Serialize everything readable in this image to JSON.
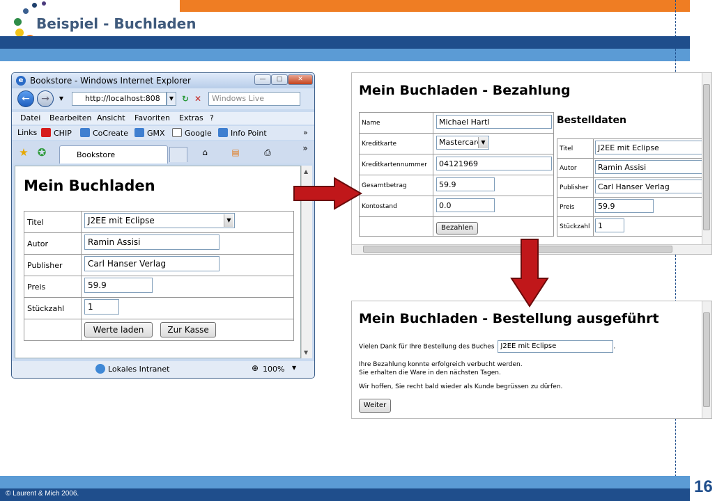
{
  "slide": {
    "title": "Beispiel - Buchladen",
    "copyright": "© Laurent & Mich 2006.",
    "page_number": "16",
    "colors": {
      "navy": "#1f4e8c",
      "light_blue": "#5b9bd5",
      "orange": "#ef7d23",
      "arrow_red": "#c0171a"
    }
  },
  "browser": {
    "window_title": "Bookstore - Windows Internet Explorer",
    "address": "http://localhost:808",
    "search_placeholder": "Windows Live",
    "menu": [
      "Datei",
      "Bearbeiten",
      "Ansicht",
      "Favoriten",
      "Extras",
      "?"
    ],
    "links_label": "Links",
    "links": [
      "CHIP",
      "CoCreate",
      "GMX",
      "Google",
      "Info Point"
    ],
    "tab_title": "Bookstore",
    "status_zone": "Lokales Intranet",
    "zoom": "100%"
  },
  "shop": {
    "heading": "Mein Buchladen",
    "rows": [
      {
        "label": "Titel",
        "value": "J2EE mit Eclipse"
      },
      {
        "label": "Autor",
        "value": "Ramin Assisi"
      },
      {
        "label": "Publisher",
        "value": "Carl Hanser Verlag"
      },
      {
        "label": "Preis",
        "value": "59.9"
      },
      {
        "label": "Stückzahl",
        "value": "1"
      }
    ],
    "load_button": "Werte laden",
    "checkout_button": "Zur Kasse"
  },
  "payment": {
    "heading": "Mein Buchladen - Bezahlung",
    "rows": [
      {
        "label": "Name",
        "value": "Michael Hartl"
      },
      {
        "label": "Kreditkarte",
        "value": "Mastercard"
      },
      {
        "label": "Kreditkartennummer",
        "value": "04121969"
      },
      {
        "label": "Gesamtbetrag",
        "value": "59.9"
      },
      {
        "label": "Kontostand",
        "value": "0.0"
      }
    ],
    "pay_button": "Bezahlen",
    "order_heading": "Bestelldaten",
    "order_rows": [
      {
        "label": "Titel",
        "value": "J2EE mit Eclipse"
      },
      {
        "label": "Autor",
        "value": "Ramin Assisi"
      },
      {
        "label": "Publisher",
        "value": "Carl Hanser Verlag"
      },
      {
        "label": "Preis",
        "value": "59.9"
      },
      {
        "label": "Stückzahl",
        "value": "1"
      }
    ]
  },
  "confirmation": {
    "heading": "Mein Buchladen - Bestellung ausgeführt",
    "thanks_text": "Vielen Dank für Ihre Bestellung des Buches",
    "book_title": "J2EE mit Eclipse",
    "period": ".",
    "line2": "Ihre Bezahlung konnte erfolgreich verbucht werden.",
    "line3": "Sie erhalten die Ware in den nächsten Tagen.",
    "line4": "Wir hoffen, Sie recht bald wieder als Kunde begrüssen zu dürfen.",
    "continue_button": "Weiter"
  }
}
